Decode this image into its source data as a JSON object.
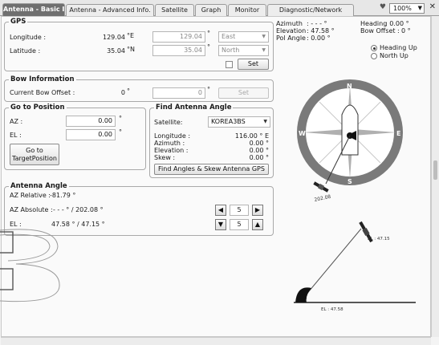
{
  "tabs": [
    {
      "label": "Antenna - Basic Info."
    },
    {
      "label": "Antenna - Advanced Info."
    },
    {
      "label": "Satellite"
    },
    {
      "label": "Graph"
    },
    {
      "label": "Monitor"
    },
    {
      "label": "Diagnostic/Network"
    }
  ],
  "toolbar": {
    "zoom": "100%"
  },
  "gps": {
    "title": "GPS",
    "longitude_label": "Longitude :",
    "longitude_value": "129.04",
    "longitude_unit": "°E",
    "latitude_label": "Latitude :",
    "latitude_value": "35.04",
    "latitude_unit": "°N",
    "lon_input": "129.04",
    "lat_input": "35.04",
    "lon_dir": "East",
    "lat_dir": "North",
    "deg": "°",
    "set_label": "Set"
  },
  "bow": {
    "title": "Bow Information",
    "offset_label": "Current Bow Offset :",
    "offset_value": "0",
    "offset_input": "0",
    "set_label": "Set"
  },
  "goto": {
    "title": "Go to Position",
    "az_label": "AZ :",
    "az_value": "0.00",
    "el_label": "EL :",
    "el_value": "0.00",
    "button_label": "Go to TargetPosition"
  },
  "find": {
    "title": "Find Antenna Angle",
    "satellite_label": "Satellite:",
    "satellite_value": "KOREA3BS",
    "longitude_label": "Longitude :",
    "longitude_value": "116.00 ° E",
    "azimuth_label": "Azimuth :",
    "azimuth_value": "0.00 °",
    "elevation_label": "Elevation :",
    "elevation_value": "0.00 °",
    "skew_label": "Skew :",
    "skew_value": "0.00 °",
    "button_label": "Find Angles & Skew Antenna GPS"
  },
  "antenna": {
    "title": "Antenna Angle",
    "az_rel_label": "AZ Relative :",
    "az_rel_value": "-81.79 °",
    "az_abs_label": "AZ Absolute :",
    "az_abs_value": "- - - ° / 202.08 °",
    "el_label": "EL :",
    "el_value": "47.58 ° / 47.15 °",
    "step1": "5",
    "step2": "5"
  },
  "status": {
    "azimuth_label": "Azimuth",
    "azimuth_value": ": - - - °",
    "elevation_label": "Elevation",
    "elevation_value": ": 47.58 °",
    "pol_label": "Pol Angle",
    "pol_value": ": 0.00 °",
    "heading_label": "Heading",
    "heading_value": ": 0.00 °",
    "bow_offset_label": "Bow Offset :",
    "bow_offset_value": "0 °",
    "heading_up": "Heading Up",
    "north_up": "North Up"
  },
  "compass": {
    "n": "N",
    "s": "S",
    "e": "E",
    "w": "W",
    "sat_label": "202.08"
  },
  "elevation_view": {
    "target_label": "EL : 47.15",
    "current_label": "EL : 47.58"
  }
}
